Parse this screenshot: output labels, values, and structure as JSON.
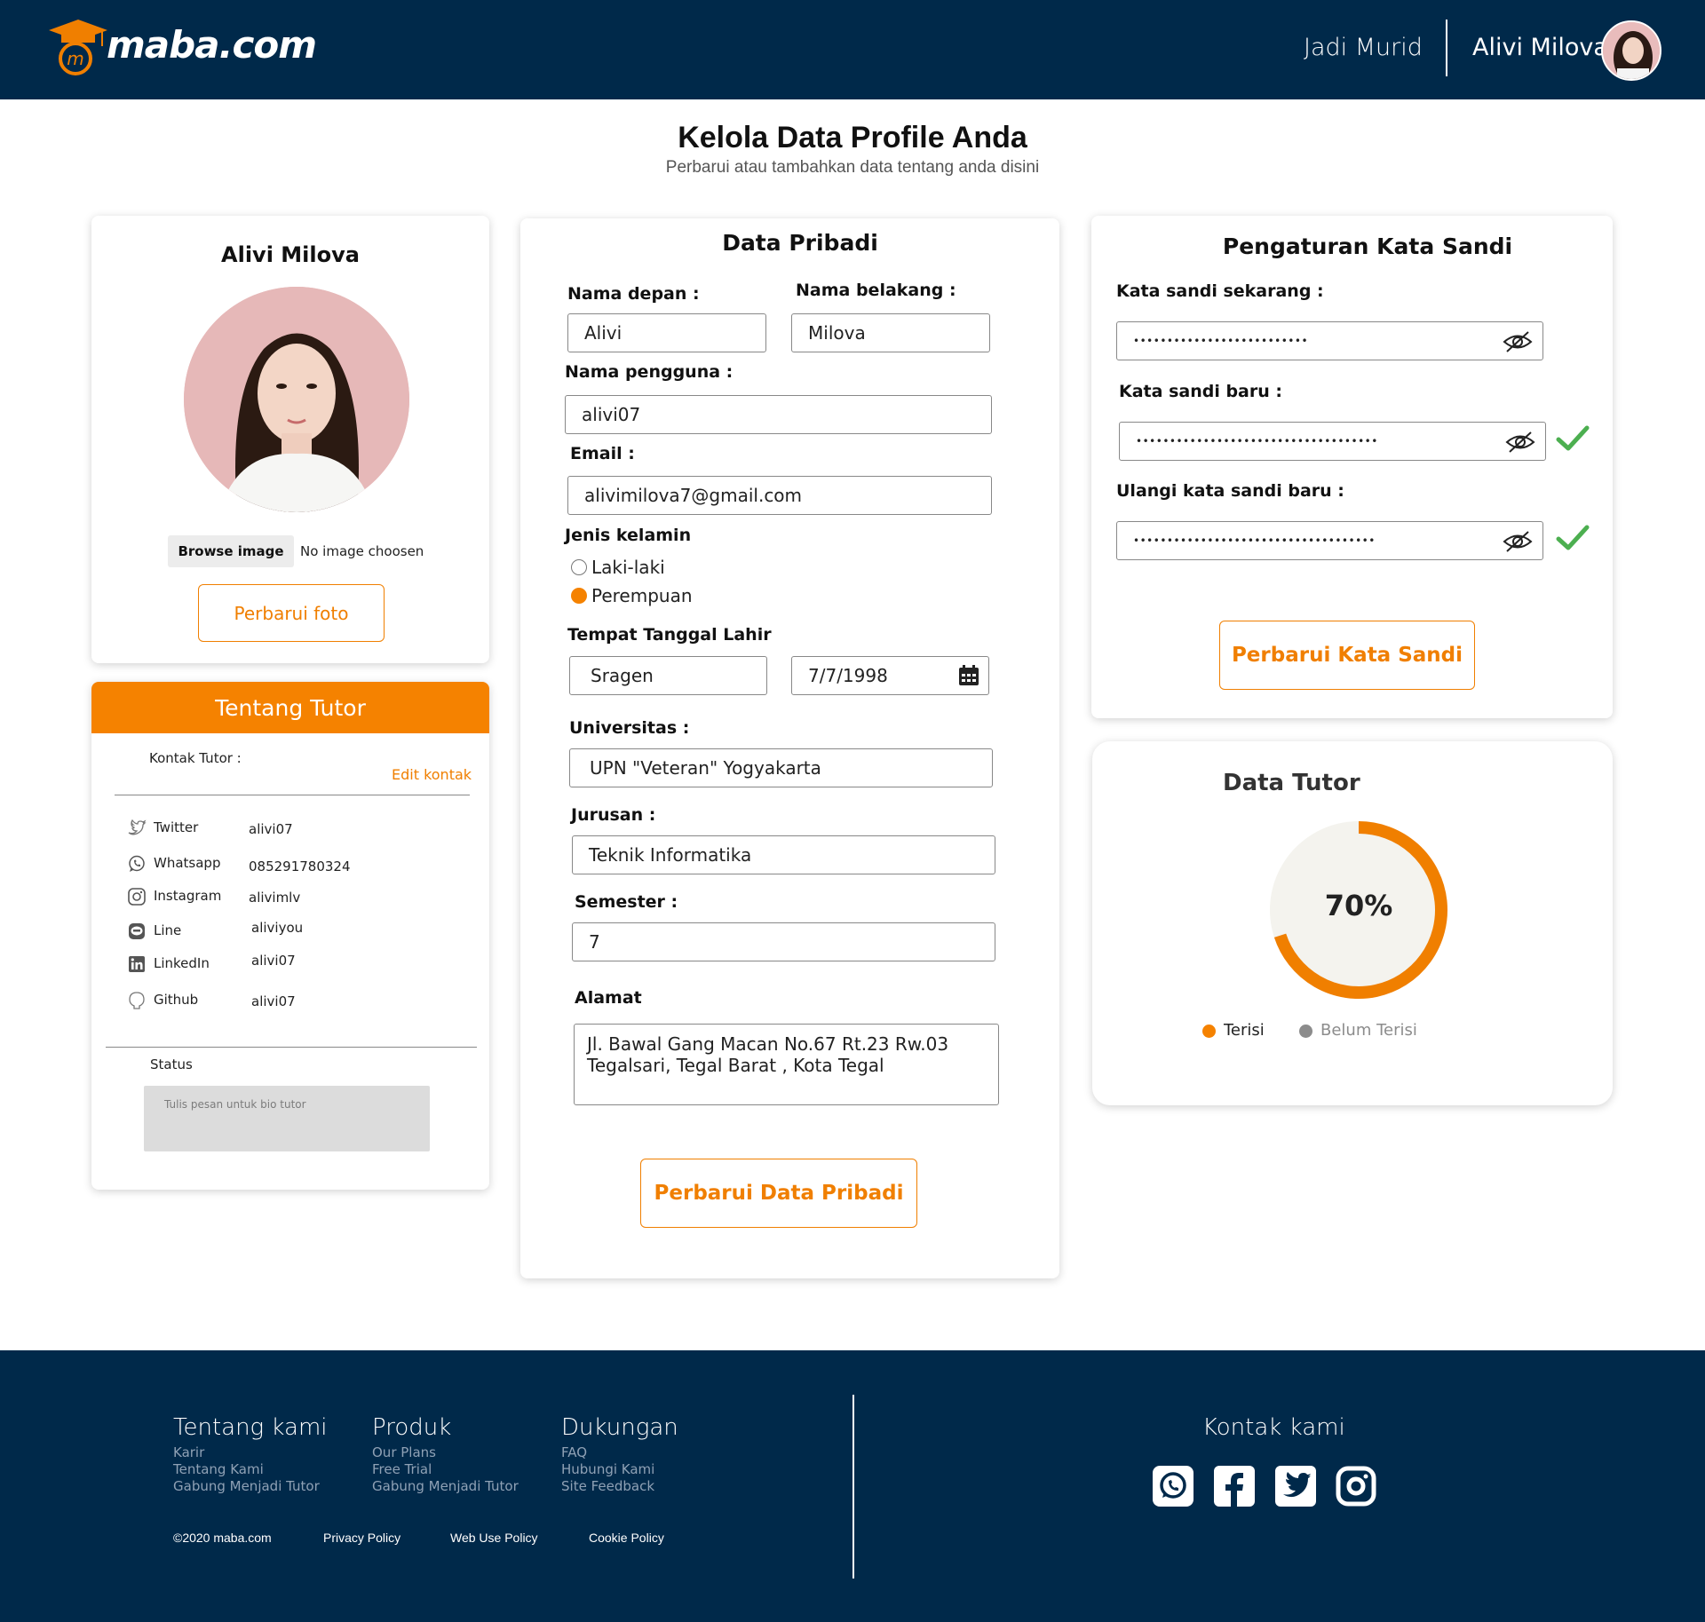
{
  "header": {
    "logo_text": "maba.com",
    "nav_link": "Jadi Murid",
    "user_name": "Alivi Milova"
  },
  "page": {
    "title": "Kelola Data Profile Anda",
    "subtitle": "Perbarui atau tambahkan data tentang anda disini"
  },
  "profile_card": {
    "name": "Alivi Milova",
    "browse_label": "Browse image",
    "file_status": "No image choosen",
    "update_photo_label": "Perbarui foto"
  },
  "tutor_card": {
    "header": "Tentang Tutor",
    "contact_label": "Kontak Tutor :",
    "edit_label": "Edit kontak",
    "contacts": [
      {
        "icon": "twitter-icon",
        "label": "Twitter",
        "value": "alivi07"
      },
      {
        "icon": "whatsapp-icon",
        "label": "Whatsapp",
        "value": "085291780324"
      },
      {
        "icon": "instagram-icon",
        "label": "Instagram",
        "value": "alivimlv"
      },
      {
        "icon": "line-icon",
        "label": "Line",
        "value": "aliviyou"
      },
      {
        "icon": "linkedin-icon",
        "label": "LinkedIn",
        "value": "alivi07"
      },
      {
        "icon": "github-icon",
        "label": "Github",
        "value": "alivi07"
      }
    ],
    "status_label": "Status",
    "status_placeholder": "Tulis pesan untuk bio tutor"
  },
  "personal": {
    "title": "Data Pribadi",
    "first_name_label": "Nama depan :",
    "first_name": "Alivi",
    "last_name_label": "Nama belakang :",
    "last_name": "Milova",
    "username_label": "Nama pengguna :",
    "username": "alivi07",
    "email_label": "Email :",
    "email": "alivimilova7@gmail.com",
    "gender_label": "Jenis kelamin",
    "gender_options": [
      "Laki-laki",
      "Perempuan"
    ],
    "gender_selected": "Perempuan",
    "birth_label": "Tempat Tanggal Lahir",
    "birth_place": "Sragen",
    "birth_date": "7/7/1998",
    "university_label": "Universitas :",
    "university": "UPN \"Veteran\" Yogyakarta",
    "major_label": "Jurusan :",
    "major": "Teknik Informatika",
    "semester_label": "Semester :",
    "semester": "7",
    "address_label": "Alamat",
    "address_line1": "Jl. Bawal Gang Macan No.67 Rt.23 Rw.03",
    "address_line2": "Tegalsari, Tegal Barat , Kota Tegal",
    "submit_label": "Perbarui Data Pribadi"
  },
  "password": {
    "title": "Pengaturan Kata Sandi",
    "current_label": "Kata sandi sekarang :",
    "current_mask": "••••••••••••••••••••••••••",
    "new_label": "Kata sandi baru :",
    "new_mask": "••••••••••••••••••••••••••••••••••••",
    "repeat_label": "Ulangi kata sandi baru :",
    "repeat_mask": "••••••••••••••••••••••••••••••••••••",
    "submit_label": "Perbarui Kata Sandi",
    "check_color": "#4caf50"
  },
  "tutor_data": {
    "title": "Data Tutor",
    "percent_text": "70%",
    "filled_fraction": 0.7,
    "legend_filled": "Terisi",
    "legend_empty": "Belum Terisi",
    "filled_color": "#f07f00",
    "empty_color": "#8c8c8c"
  },
  "footer": {
    "col1_title": "Tentang kami",
    "col1_links": [
      "Karir",
      "Tentang Kami",
      "Gabung Menjadi Tutor"
    ],
    "col2_title": "Produk",
    "col2_links": [
      "Our Plans",
      "Free Trial",
      "Gabung Menjadi Tutor"
    ],
    "col3_title": "Dukungan",
    "col3_links": [
      "FAQ",
      "Hubungi Kami",
      "Site Feedback"
    ],
    "copyright": "©2020 maba.com",
    "legal": [
      "Privacy Policy",
      "Web Use Policy",
      "Cookie Policy"
    ],
    "contact_title": "Kontak kami",
    "social_icons": [
      "whatsapp-icon",
      "facebook-icon",
      "twitter-icon",
      "instagram-icon"
    ]
  },
  "colors": {
    "navy": "#00294a",
    "accent": "#f07f00"
  }
}
